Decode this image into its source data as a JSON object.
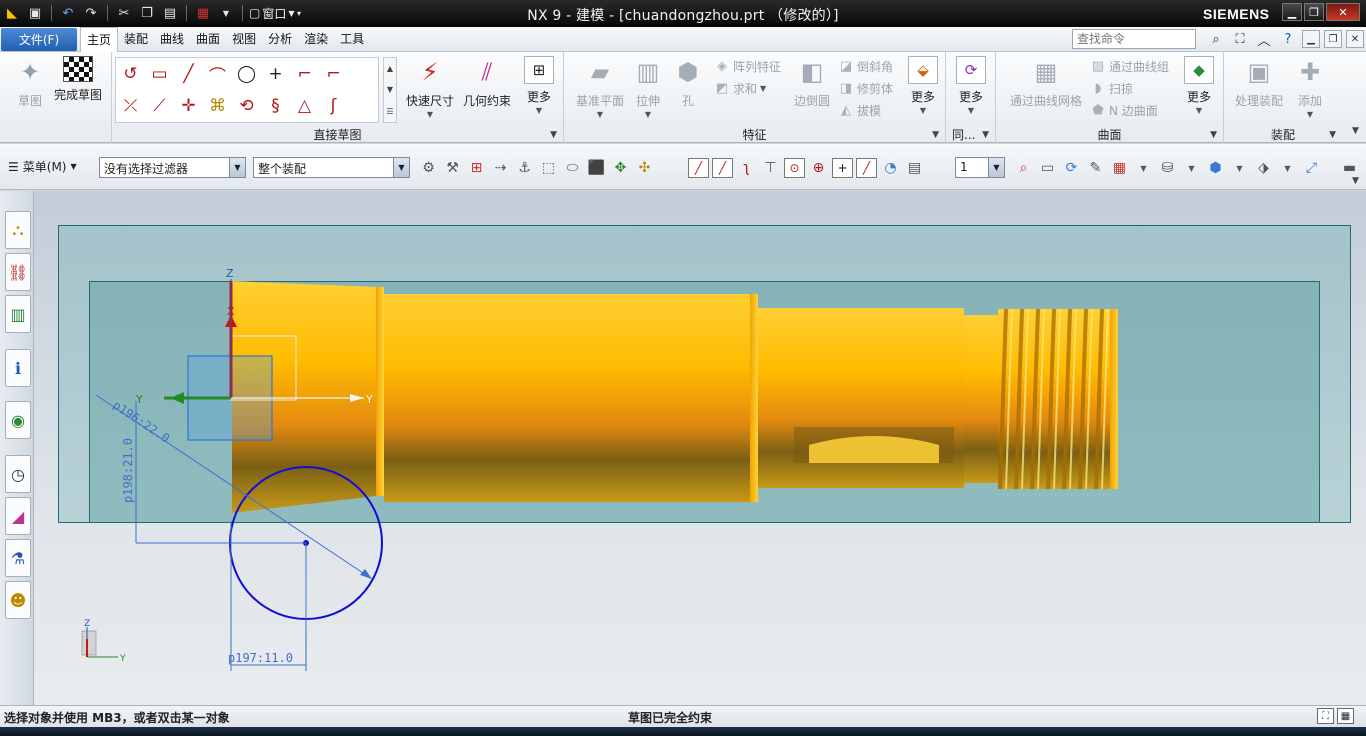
{
  "titlebar": {
    "title": "NX 9 - 建模 - [chuandongzhou.prt （修改的）]",
    "brand": "SIEMENS",
    "window_menu": "窗口",
    "qat_icons": [
      "nx-logo-icon",
      "save-icon",
      "undo-icon",
      "redo-icon",
      "cut-icon",
      "copy-icon",
      "paste-icon",
      "window-icon"
    ]
  },
  "tabs": {
    "file": "文件(F)",
    "items": [
      "主页",
      "装配",
      "曲线",
      "曲面",
      "视图",
      "分析",
      "渲染",
      "工具"
    ],
    "active": "主页",
    "search_placeholder": "查找命令"
  },
  "ribbon": {
    "sketch": {
      "sketch": "草图",
      "finish": "完成草图"
    },
    "direct_sketch": {
      "label": "直接草图",
      "quick_dim": "快速尺寸",
      "geo_constraint": "几何约束",
      "more": "更多",
      "tools": [
        "profile-icon",
        "rectangle-icon",
        "line-icon",
        "arc-icon",
        "circle-icon",
        "point-icon",
        "fillet-icon",
        "chamfer-icon",
        "",
        "trim-icon",
        "extend-icon",
        "make-corner-icon",
        "offset-curve-icon",
        "pattern-curve-icon",
        "mirror-curve-icon",
        "derived-line-icon",
        "convert-icon",
        ""
      ]
    },
    "feature": {
      "label": "特征",
      "datum_plane": "基准平面",
      "extrude": "拉伸",
      "hole": "孔",
      "pattern": "阵列特征",
      "unite": "求和",
      "edge_blend": "边倒圆",
      "chamfer": "倒斜角",
      "trim_body": "修剪体",
      "draft": "拔模",
      "more": "更多"
    },
    "sync": {
      "label": "同...",
      "more": "更多"
    },
    "surface": {
      "label": "曲面",
      "through_mesh": "通过曲线网格",
      "through_curves": "通过曲线组",
      "swept": "扫掠",
      "n_sided": "N 边曲面",
      "more": "更多"
    },
    "assembly": {
      "label": "装配",
      "process": "处理装配",
      "add": "添加"
    }
  },
  "selbar": {
    "menu": "菜单(M)",
    "filter": "没有选择过滤器",
    "scope": "整个装配",
    "layer": "1"
  },
  "graphics": {
    "dims": {
      "diameter": "p196:22.0",
      "vertical": "p198:21.0",
      "horizontal": "p197:11.0"
    },
    "axes": {
      "x": "X",
      "y": "Y",
      "z": "Z"
    }
  },
  "status": {
    "prompt": "选择对象并使用 MB3，或者双击某一对象",
    "message": "草图已完全约束"
  }
}
